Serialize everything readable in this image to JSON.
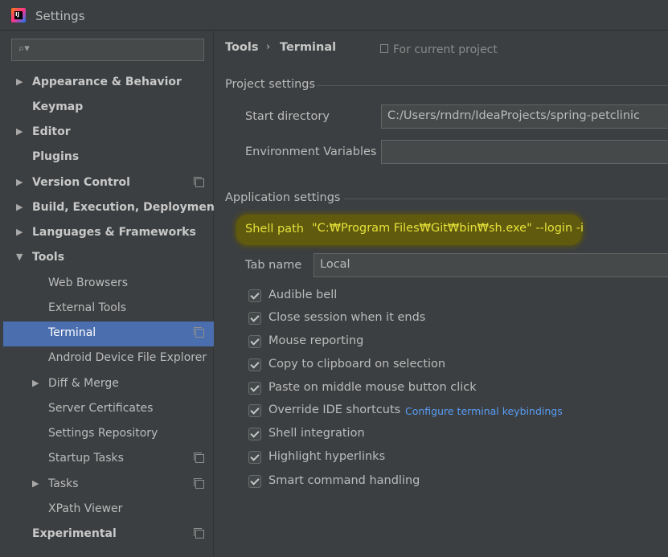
{
  "window": {
    "title": "Settings",
    "app_icon_text": "IJ"
  },
  "search": {
    "placeholder": "",
    "value": ""
  },
  "sidebar": {
    "items": [
      {
        "label": "Appearance & Behavior",
        "level": 0,
        "bold": true,
        "arrow": "▶",
        "proj": false
      },
      {
        "label": "Keymap",
        "level": 0,
        "bold": true,
        "arrow": "",
        "proj": false
      },
      {
        "label": "Editor",
        "level": 0,
        "bold": true,
        "arrow": "▶",
        "proj": false
      },
      {
        "label": "Plugins",
        "level": 0,
        "bold": true,
        "arrow": "",
        "proj": false
      },
      {
        "label": "Version Control",
        "level": 0,
        "bold": true,
        "arrow": "▶",
        "proj": true
      },
      {
        "label": "Build, Execution, Deployment",
        "level": 0,
        "bold": true,
        "arrow": "▶",
        "proj": false
      },
      {
        "label": "Languages & Frameworks",
        "level": 0,
        "bold": true,
        "arrow": "▶",
        "proj": false
      },
      {
        "label": "Tools",
        "level": 0,
        "bold": true,
        "arrow": "▼",
        "proj": false
      },
      {
        "label": "Web Browsers",
        "level": 1,
        "bold": false,
        "arrow": "",
        "proj": false
      },
      {
        "label": "External Tools",
        "level": 1,
        "bold": false,
        "arrow": "",
        "proj": false
      },
      {
        "label": "Terminal",
        "level": 1,
        "bold": false,
        "arrow": "",
        "proj": true,
        "selected": true
      },
      {
        "label": "Android Device File Explorer",
        "level": 1,
        "bold": false,
        "arrow": "",
        "proj": false
      },
      {
        "label": "Diff & Merge",
        "level": 1,
        "bold": false,
        "arrow": "▶",
        "proj": false
      },
      {
        "label": "Server Certificates",
        "level": 1,
        "bold": false,
        "arrow": "",
        "proj": false
      },
      {
        "label": "Settings Repository",
        "level": 1,
        "bold": false,
        "arrow": "",
        "proj": false
      },
      {
        "label": "Startup Tasks",
        "level": 1,
        "bold": false,
        "arrow": "",
        "proj": true
      },
      {
        "label": "Tasks",
        "level": 1,
        "bold": false,
        "arrow": "▶",
        "proj": true
      },
      {
        "label": "XPath Viewer",
        "level": 1,
        "bold": false,
        "arrow": "",
        "proj": false
      },
      {
        "label": "Experimental",
        "level": 0,
        "bold": true,
        "arrow": "",
        "proj": true
      }
    ]
  },
  "breadcrumb": {
    "parent": "Tools",
    "separator": "›",
    "current": "Terminal",
    "scope": "For current project"
  },
  "project_settings": {
    "title": "Project settings",
    "start_directory_label": "Start directory",
    "start_directory_value": "C:/Users/rndrn/IdeaProjects/spring-petclinic",
    "env_vars_label": "Environment Variables",
    "env_vars_value": ""
  },
  "application_settings": {
    "title": "Application settings",
    "shell_path_label": "Shell path",
    "shell_path_value": "\"C:₩Program Files₩Git₩bin₩sh.exe\" --login -i",
    "tab_name_label": "Tab name",
    "tab_name_value": "Local",
    "checkboxes": [
      {
        "label": "Audible bell",
        "checked": true
      },
      {
        "label": "Close session when it ends",
        "checked": true
      },
      {
        "label": "Mouse reporting",
        "checked": true
      },
      {
        "label": "Copy to clipboard on selection",
        "checked": true
      },
      {
        "label": "Paste on middle mouse button click",
        "checked": true
      },
      {
        "label": "Override IDE shortcuts",
        "checked": true,
        "link": "Configure terminal keybindings"
      },
      {
        "label": "Shell integration",
        "checked": true
      },
      {
        "label": "Highlight hyperlinks",
        "checked": true
      },
      {
        "label": "Smart command handling",
        "checked": true
      }
    ]
  },
  "colors": {
    "background": "#3c3f41",
    "selection": "#4b6eaf",
    "highlight": "#e7e13a",
    "link": "#589df6"
  }
}
